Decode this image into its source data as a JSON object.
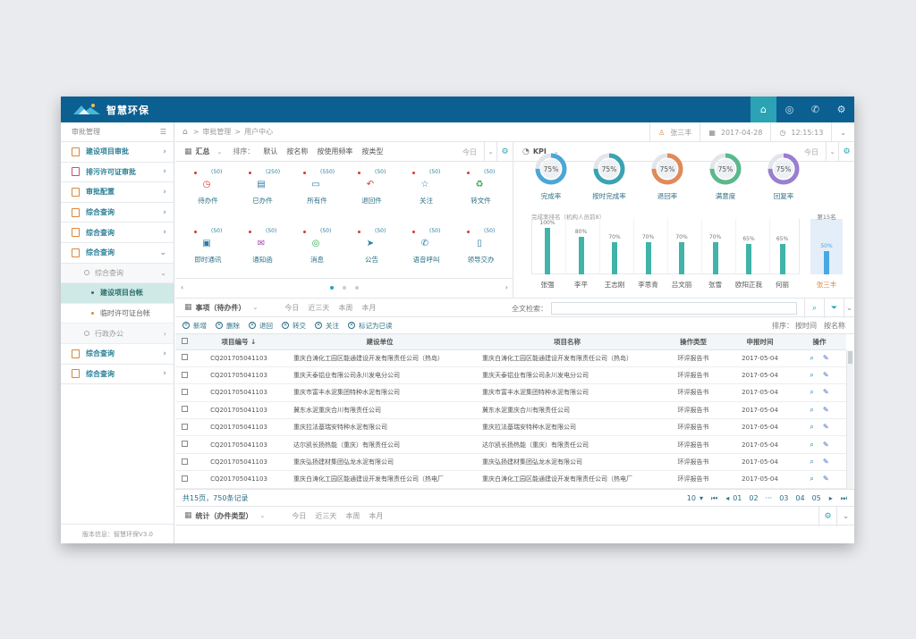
{
  "app": {
    "brand": "智慧环保",
    "colors": {
      "topbar": "#0c5f91",
      "accent": "#2ba3b5",
      "teal": "#40b4a8"
    },
    "top_icons": [
      "home-icon",
      "compass-icon",
      "phone-icon",
      "gear-icon"
    ]
  },
  "sidebar": {
    "header": "审批管理",
    "items": [
      {
        "label": "建设项目审批"
      },
      {
        "label": "排污许可证审批"
      },
      {
        "label": "审批配置"
      },
      {
        "label": "综合查询"
      },
      {
        "label": "综合查询"
      },
      {
        "label": "综合查询"
      }
    ],
    "sub_group": "综合查询",
    "leaves": [
      "建设项目台帐",
      "临时许可证台帐"
    ],
    "sub_group2": "行政办公",
    "tail_items": [
      {
        "label": "综合查询"
      },
      {
        "label": "综合查询"
      }
    ],
    "version": "版本信息：智慧环保V3.0"
  },
  "breadcrumb": {
    "home": "⌂",
    "sep": ">",
    "level1": "审批管理",
    "level2": "用户中心"
  },
  "user": {
    "name": "张三丰",
    "date": "2017-04-28",
    "time": "12:15:13"
  },
  "summary": {
    "title": "汇总",
    "sort_label": "排序：",
    "sort_options": [
      "默认",
      "按名称",
      "按使用频率",
      "按类型"
    ],
    "range": "今日",
    "tiles": [
      {
        "label": "待办件",
        "count": "(50)",
        "icon": "clock-icon",
        "glyph": "◷",
        "color": "#d23a3a"
      },
      {
        "label": "已办件",
        "count": "(250)",
        "icon": "document-icon",
        "glyph": "▤",
        "color": "#2b7ea3"
      },
      {
        "label": "所有件",
        "count": "(550)",
        "icon": "monitor-icon",
        "glyph": "▭",
        "color": "#2b7ea3"
      },
      {
        "label": "退回件",
        "count": "(50)",
        "icon": "undo-icon",
        "glyph": "↶",
        "color": "#d23a3a"
      },
      {
        "label": "关注",
        "count": "(50)",
        "icon": "star-icon",
        "glyph": "☆",
        "color": "#2b7ea3"
      },
      {
        "label": "转文件",
        "count": "(50)",
        "icon": "recycle-icon",
        "glyph": "♻",
        "color": "#2aa84a"
      },
      {
        "label": "即时通讯",
        "count": "(50)",
        "icon": "chat-doc-icon",
        "glyph": "▣",
        "color": "#2b7ea3"
      },
      {
        "label": "通知函",
        "count": "(50)",
        "icon": "mail-icon",
        "glyph": "✉",
        "color": "#a04aa8"
      },
      {
        "label": "消息",
        "count": "(50)",
        "icon": "message-icon",
        "glyph": "◎",
        "color": "#2aa84a"
      },
      {
        "label": "公告",
        "count": "(50)",
        "icon": "send-icon",
        "glyph": "➤",
        "color": "#2b7ea3"
      },
      {
        "label": "语音呼叫",
        "count": "(50)",
        "icon": "phone-icon",
        "glyph": "✆",
        "color": "#2b7ea3"
      },
      {
        "label": "领导交办",
        "count": "(50)",
        "icon": "file-icon",
        "glyph": "▯",
        "color": "#2b7ea3"
      }
    ]
  },
  "kpi": {
    "title": "KPI",
    "range": "今日",
    "rings": [
      {
        "label": "完成率",
        "value": "75%",
        "color": "#4aa7d6"
      },
      {
        "label": "按时完成率",
        "value": "75%",
        "color": "#3aa3b3"
      },
      {
        "label": "退回率",
        "value": "75%",
        "color": "#e08a5a"
      },
      {
        "label": "满意度",
        "value": "75%",
        "color": "#5bb88a"
      },
      {
        "label": "回复率",
        "value": "75%",
        "color": "#9a7fd0"
      }
    ],
    "rank_title": "完成率排名（机构人员前8）",
    "rank_extra_title": "第15名",
    "bars": [
      {
        "name": "张强",
        "value": 100,
        "label": "100%"
      },
      {
        "name": "李平",
        "value": 80,
        "label": "80%"
      },
      {
        "name": "王志刚",
        "value": 70,
        "label": "70%"
      },
      {
        "name": "李思青",
        "value": 70,
        "label": "70%"
      },
      {
        "name": "吕文丽",
        "value": 70,
        "label": "70%"
      },
      {
        "name": "张雪",
        "value": 70,
        "label": "70%"
      },
      {
        "name": "欧阳正我",
        "value": 65,
        "label": "65%"
      },
      {
        "name": "何丽",
        "value": 65,
        "label": "65%"
      }
    ],
    "highlight": {
      "name": "张三丰",
      "value": 50,
      "label": "50%"
    }
  },
  "list": {
    "title": "事项（待办件）",
    "ranges": [
      "今日",
      "近三天",
      "本周",
      "本月"
    ],
    "search_label": "全文检索：",
    "search_placeholder": "",
    "tools": [
      "新增",
      "删除",
      "退回",
      "转交",
      "关注",
      "标记为已读"
    ],
    "sort_label": "排序：",
    "sort_options": [
      "按时间",
      "按名称"
    ],
    "headers": [
      "项目编号",
      "建设单位",
      "项目名称",
      "操作类型",
      "申报时间",
      "操作"
    ],
    "rows": [
      [
        "CQ201705041103",
        "重庆白涛化工园区能通建设开发有限责任公司（热岛）",
        "重庆白涛化工园区能通建设开发有限责任公司（热岛）",
        "环评报告书",
        "2017-05-04"
      ],
      [
        "CQ201705041103",
        "重庆天泰铝业有限公司永川发电分公司",
        "重庆天泰铝业有限公司永川发电分公司",
        "环评报告书",
        "2017-05-04"
      ],
      [
        "CQ201705041103",
        "重庆市富丰水泥集团特种水泥有限公司",
        "重庆市富丰水泥集团特种水泥有限公司",
        "环评报告书",
        "2017-05-04"
      ],
      [
        "CQ201705041103",
        "冀东水泥重庆合川有限责任公司",
        "冀东水泥重庆合川有限责任公司",
        "环评报告书",
        "2017-05-04"
      ],
      [
        "CQ201705041103",
        "重庆拉法基瑞安特种水泥有限公司",
        "重庆拉法基瑞安特种水泥有限公司",
        "环评报告书",
        "2017-05-04"
      ],
      [
        "CQ201705041103",
        "达尔凯长扬热能（重庆）有限责任公司",
        "达尔凯长扬热能（重庆）有限责任公司",
        "环评报告书",
        "2017-05-04"
      ],
      [
        "CQ201705041103",
        "重庆弘扬建材集团弘龙水泥有限公司",
        "重庆弘扬建材集团弘龙水泥有限公司",
        "环评报告书",
        "2017-05-04"
      ],
      [
        "CQ201705041103",
        "重庆白涛化工园区能通建设开发有限责任公司（热电厂",
        "重庆白涛化工园区能通建设开发有限责任公司（热电厂",
        "环评报告书",
        "2017-05-04"
      ]
    ],
    "summary": "共15页，750条记录",
    "page_size": "10",
    "pages": [
      "01",
      "02",
      "···",
      "03",
      "04",
      "05"
    ]
  },
  "stats": {
    "title": "统计（办件类型）",
    "ranges": [
      "今日",
      "近三天",
      "本周",
      "本月"
    ]
  }
}
